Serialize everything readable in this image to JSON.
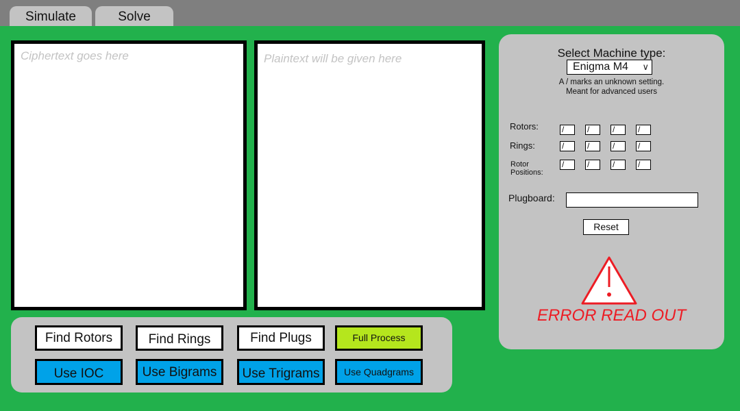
{
  "tabs": {
    "simulate": "Simulate",
    "solve": "Solve"
  },
  "ciphertext": {
    "placeholder": "Ciphertext goes here",
    "value": ""
  },
  "plaintext": {
    "placeholder": "Plaintext will be given here",
    "value": ""
  },
  "actions": {
    "row1": [
      {
        "label": "Find Rotors",
        "style": "white"
      },
      {
        "label": "Find Rings",
        "style": "white"
      },
      {
        "label": "Find Plugs",
        "style": "white"
      },
      {
        "label": "Full Process",
        "style": "lime"
      }
    ],
    "row2": [
      {
        "label": "Use IOC",
        "style": "blue"
      },
      {
        "label": "Use Bigrams",
        "style": "blue"
      },
      {
        "label": "Use Trigrams",
        "style": "blue"
      },
      {
        "label": "Use Quadgrams",
        "style": "blue"
      }
    ]
  },
  "settings": {
    "select_label": "Select Machine type:",
    "machine_type": "Enigma M4",
    "note_line1": "A / marks an unknown setting.",
    "note_line2": "Meant for advanced users",
    "rotors_label": "Rotors:",
    "rings_label": "Rings:",
    "positions_label_line1": "Rotor",
    "positions_label_line2": "Positions:",
    "rotors": [
      "/",
      "/",
      "/",
      "/"
    ],
    "rings": [
      "/",
      "/",
      "/",
      "/"
    ],
    "positions": [
      "/",
      "/",
      "/",
      "/"
    ],
    "plugboard_label": "Plugboard:",
    "plugboard_value": "",
    "reset_label": "Reset",
    "error_text": "ERROR READ OUT"
  },
  "colors": {
    "background": "#22b14c",
    "topbar": "#7f7f7f",
    "panel": "#c3c3c3",
    "blue_button": "#00a2e8",
    "lime_button": "#b5e61d",
    "error": "#ed1c24"
  },
  "icons": {
    "warning": "warning-triangle-icon",
    "dropdown": "chevron-down-icon"
  }
}
